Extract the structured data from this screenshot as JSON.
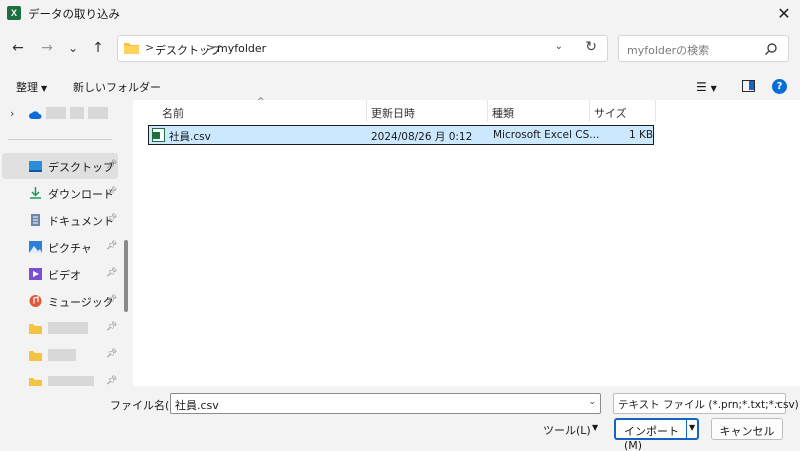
{
  "window": {
    "title": "データの取り込み",
    "app_icon_letter": "X",
    "close_glyph": "✕"
  },
  "nav": {
    "back": "←",
    "forward": "→",
    "recent": "⌄",
    "up": "↑"
  },
  "address": {
    "crumbs": [
      "デスクトップ",
      "myfolder"
    ],
    "separator": ">"
  },
  "search": {
    "placeholder": "myfolderの検索"
  },
  "toolbar": {
    "organize_label": "整理",
    "new_folder_label": "新しいフォルダー"
  },
  "sidebar": {
    "items": [
      {
        "label": "デスクトップ",
        "icon": "desktop-icon",
        "pinned": true,
        "selected": true
      },
      {
        "label": "ダウンロード",
        "icon": "download-icon",
        "pinned": true
      },
      {
        "label": "ドキュメント",
        "icon": "document-icon",
        "pinned": true
      },
      {
        "label": "ピクチャ",
        "icon": "pictures-icon",
        "pinned": true
      },
      {
        "label": "ビデオ",
        "icon": "video-icon",
        "pinned": true
      },
      {
        "label": "ミュージック",
        "icon": "music-icon",
        "pinned": true
      }
    ]
  },
  "file_list": {
    "columns": [
      "名前",
      "更新日時",
      "種類",
      "サイズ"
    ],
    "rows": [
      {
        "name": "社員.csv",
        "modified": "2024/08/26 月 0:12",
        "type": "Microsoft Excel CS...",
        "size": "1 KB"
      }
    ]
  },
  "bottom": {
    "filename_label": "ファイル名(N):",
    "filename_value": "社員.csv",
    "filetype_value": "テキスト ファイル (*.prn;*.txt;*.csv)",
    "tools_label": "ツール(L)",
    "import_label": "インポート(M)",
    "cancel_label": "キャンセル"
  },
  "colors": {
    "accent": "#1565c0",
    "selection": "#cce8ff",
    "excel_green": "#1d6f42"
  }
}
